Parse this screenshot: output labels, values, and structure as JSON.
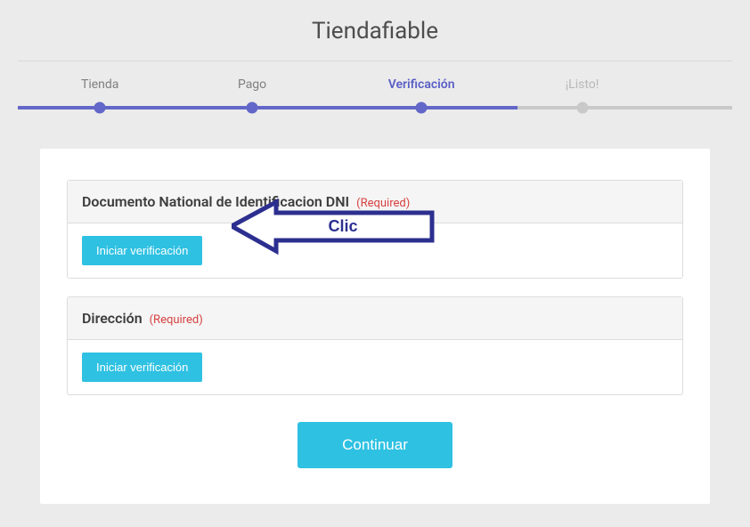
{
  "header": {
    "title": "Tiendafiable"
  },
  "stepper": {
    "steps": [
      {
        "label": "Tienda"
      },
      {
        "label": "Pago"
      },
      {
        "label": "Verificación"
      },
      {
        "label": "¡Listo!"
      }
    ]
  },
  "panels": {
    "dni": {
      "title": "Documento National de Identificacion DNI",
      "required": "(Required)",
      "button": "Iniciar verificación"
    },
    "direccion": {
      "title": "Dirección",
      "required": "(Required)",
      "button": "Iniciar verificación"
    }
  },
  "continue_label": "Continuar",
  "annotation": {
    "text": "Clic"
  }
}
